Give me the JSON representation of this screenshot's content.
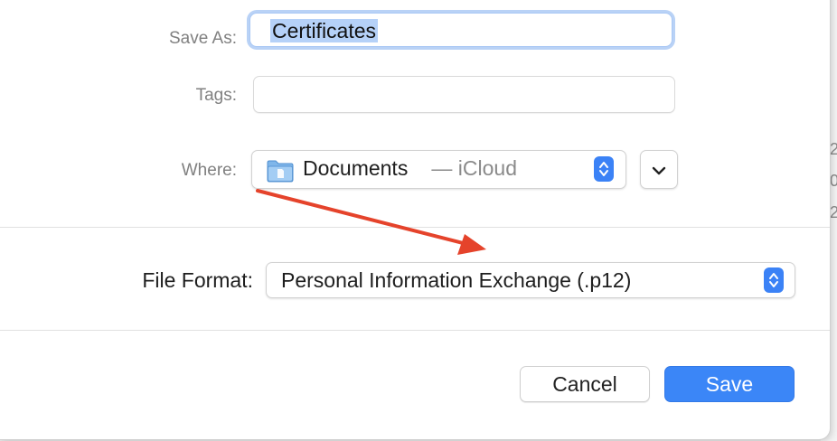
{
  "dialog": {
    "save_as": {
      "label": "Save As:",
      "value": "Certificates"
    },
    "tags": {
      "label": "Tags:",
      "value": ""
    },
    "where": {
      "label": "Where:",
      "folder": "Documents",
      "location_suffix": " — iCloud",
      "folder_icon": "folder-icon"
    },
    "file_format": {
      "label": "File Format:",
      "selected": "Personal Information Exchange (.p12)"
    },
    "buttons": {
      "cancel": "Cancel",
      "save": "Save"
    }
  },
  "annotation": {
    "arrow_color": "#e5432b"
  },
  "colors": {
    "accent": "#3b86f7",
    "selection": "#b5d1f8"
  }
}
